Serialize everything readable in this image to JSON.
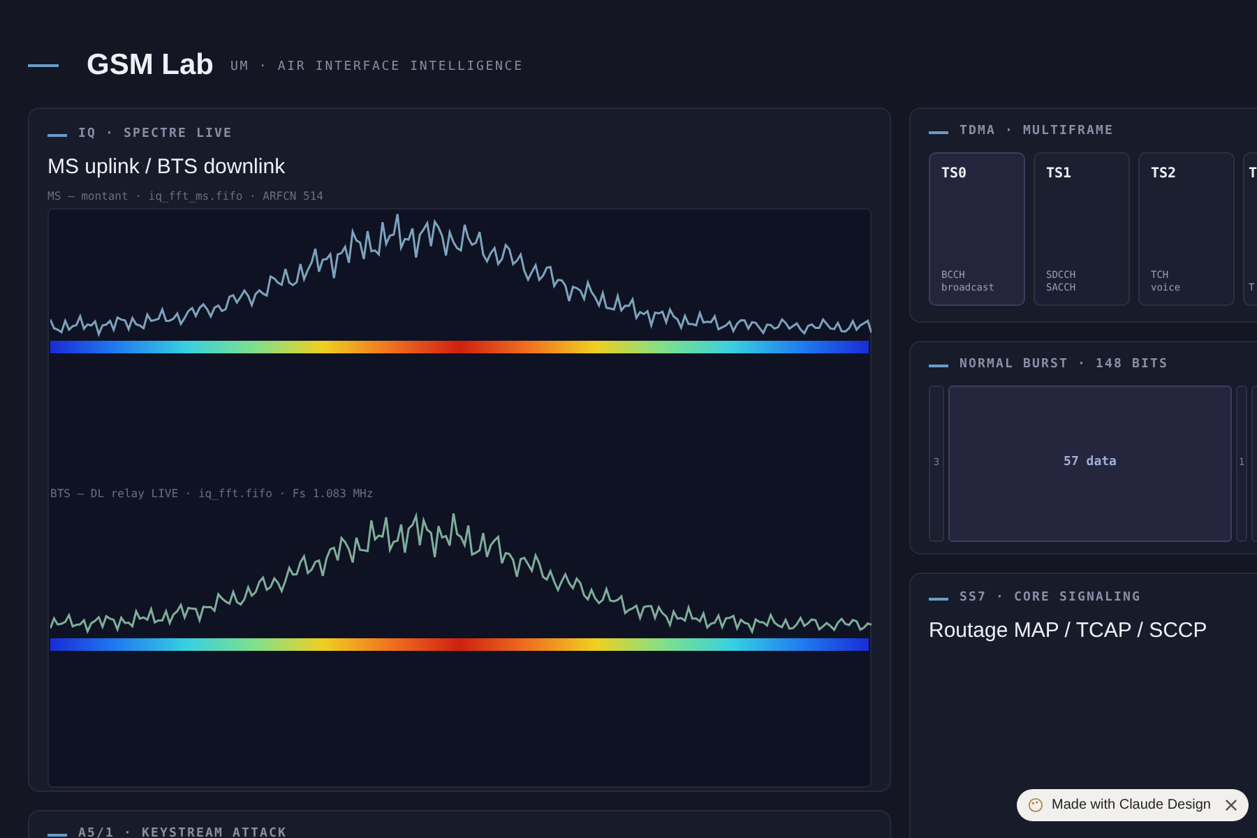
{
  "header": {
    "title": "GSM Lab",
    "subtitle": "UM · AIR INTERFACE INTELLIGENCE"
  },
  "spectrum": {
    "label": "IQ · SPECTRE LIVE",
    "title": "MS uplink / BTS downlink",
    "plots": [
      {
        "caption": "MS — montant · iq_fft_ms.fifo · ARFCN 514",
        "color": "#7ea3bd"
      },
      {
        "caption": "BTS — DL relay LIVE · iq_fft.fifo · Fs 1.083 MHz",
        "color": "#7fae9a"
      }
    ]
  },
  "attack": {
    "label": "A5/1 · KEYSTREAM ATTACK"
  },
  "tdma": {
    "label": "TDMA · MULTIFRAME",
    "slots": [
      {
        "name": "TS0",
        "lines": [
          "BCCH",
          "broadcast"
        ],
        "selected": true
      },
      {
        "name": "TS1",
        "lines": [
          "SDCCH",
          "SACCH"
        ],
        "selected": false
      },
      {
        "name": "TS2",
        "lines": [
          "TCH",
          "voice"
        ],
        "selected": false
      },
      {
        "name": "T",
        "lines": [
          "T"
        ],
        "selected": false
      }
    ]
  },
  "burst": {
    "label": "NORMAL BURST · 148 BITS",
    "segments": [
      {
        "text": "3",
        "kind": "tail"
      },
      {
        "text": "57 data",
        "kind": "data"
      },
      {
        "text": "1",
        "kind": "flag"
      },
      {
        "kind": "training"
      }
    ]
  },
  "signaling": {
    "label": "SS7 · CORE SIGNALING",
    "title": "Routage MAP / TCAP / SCCP"
  },
  "badge": {
    "text": "Made with Claude Design"
  }
}
